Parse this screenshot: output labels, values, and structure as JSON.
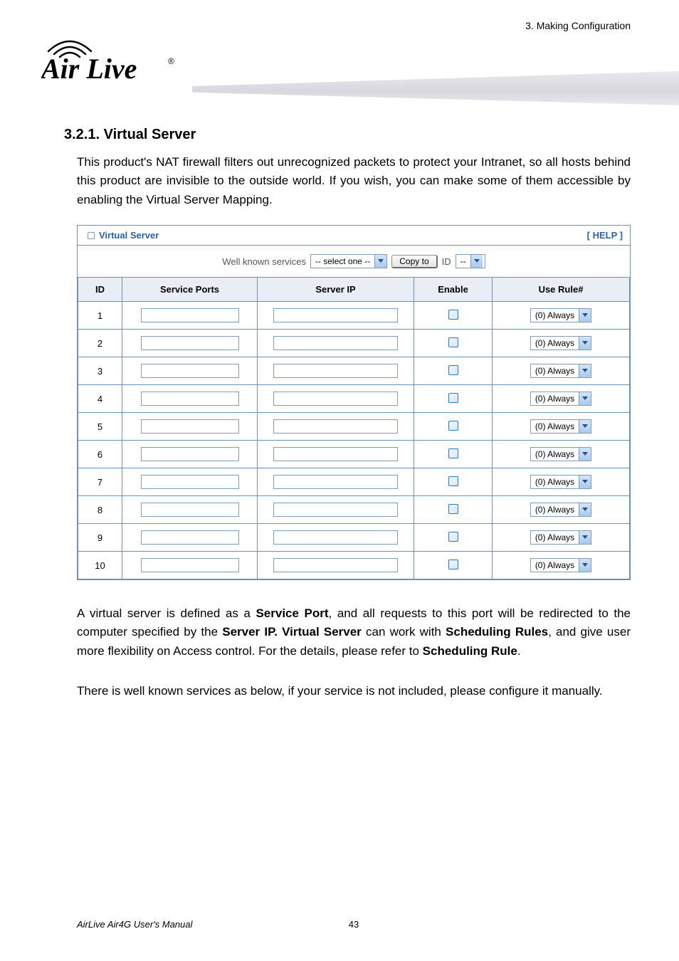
{
  "chapter": "3. Making Configuration",
  "logo": {
    "brand": "Air Live",
    "registered": "®"
  },
  "section_heading": "3.2.1.  Virtual Server",
  "intro_para": "This product's NAT firewall filters out unrecognized packets to protect your Intranet, so all hosts behind this product are invisible to the outside world. If you wish, you can make some of them accessible by enabling the Virtual Server Mapping.",
  "panel": {
    "title": "Virtual Server",
    "help": "[ HELP ]",
    "well_known_label": "Well known services",
    "well_known_value": "-- select one --",
    "copy_to": "Copy to",
    "id_label": "ID",
    "id_value": "--",
    "headers": {
      "id": "ID",
      "service_ports": "Service Ports",
      "server_ip": "Server IP",
      "enable": "Enable",
      "use_rule": "Use Rule#"
    },
    "rows": [
      {
        "id": "1",
        "svc": "",
        "ip": "",
        "enable": false,
        "rule": "(0) Always"
      },
      {
        "id": "2",
        "svc": "",
        "ip": "",
        "enable": false,
        "rule": "(0) Always"
      },
      {
        "id": "3",
        "svc": "",
        "ip": "",
        "enable": false,
        "rule": "(0) Always"
      },
      {
        "id": "4",
        "svc": "",
        "ip": "",
        "enable": false,
        "rule": "(0) Always"
      },
      {
        "id": "5",
        "svc": "",
        "ip": "",
        "enable": false,
        "rule": "(0) Always"
      },
      {
        "id": "6",
        "svc": "",
        "ip": "",
        "enable": false,
        "rule": "(0) Always"
      },
      {
        "id": "7",
        "svc": "",
        "ip": "",
        "enable": false,
        "rule": "(0) Always"
      },
      {
        "id": "8",
        "svc": "",
        "ip": "",
        "enable": false,
        "rule": "(0) Always"
      },
      {
        "id": "9",
        "svc": "",
        "ip": "",
        "enable": false,
        "rule": "(0) Always"
      },
      {
        "id": "10",
        "svc": "",
        "ip": "",
        "enable": false,
        "rule": "(0) Always"
      }
    ]
  },
  "body_para_parts": {
    "p1a": "A virtual server is defined as a ",
    "p1b": "Service Port",
    "p1c": ", and all requests to this port will be redirected to the computer specified by the ",
    "p1d": "Server IP. Virtual Server",
    "p1e": " can work with ",
    "p1f": "Scheduling Rules",
    "p1g": ", and give user more flexibility on Access control. For the details, please refer to ",
    "p1h": "Scheduling Rule",
    "p1i": "."
  },
  "body_para2": "There is well known services as below, if your service is not included, please configure it manually.",
  "footer": {
    "manual": "AirLive Air4G User's Manual",
    "page": "43"
  }
}
